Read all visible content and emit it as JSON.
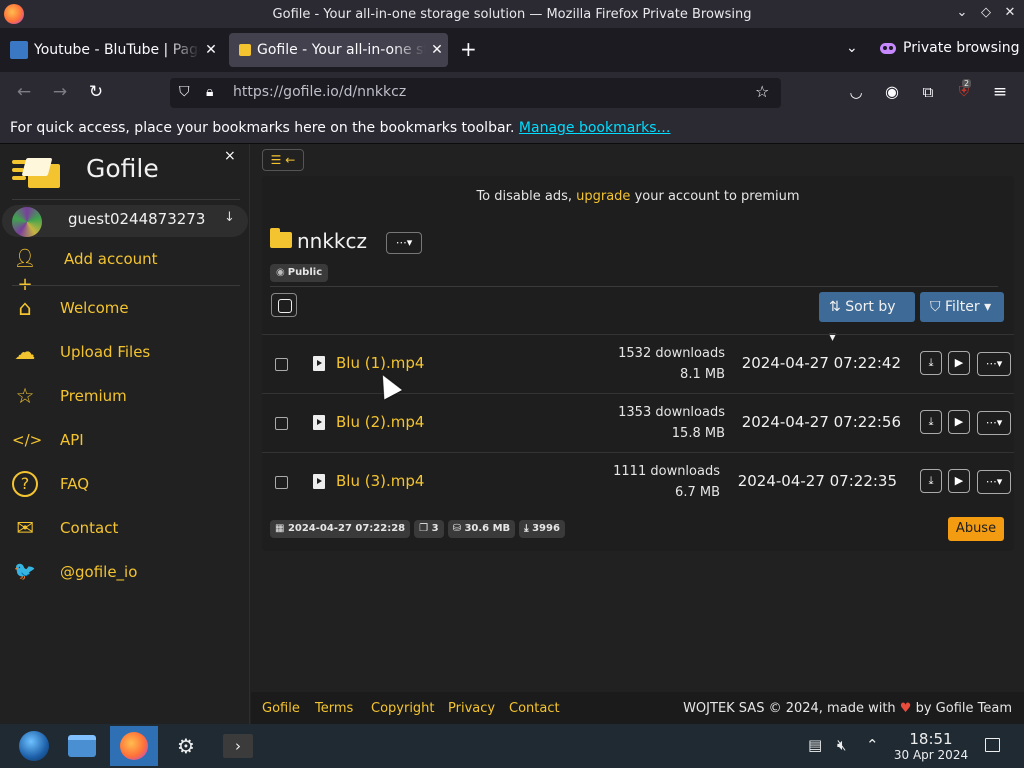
{
  "window": {
    "title": "Gofile - Your all-in-one storage solution — Mozilla Firefox Private Browsing",
    "controls": [
      "⌄",
      "◇",
      "✕"
    ]
  },
  "tabs": [
    {
      "label": "Youtube - BluTube | Page",
      "favicon_color": "#3b78c4"
    },
    {
      "label": "Gofile - Your all-in-one st",
      "favicon_color": "#f4c430"
    }
  ],
  "private_label": "Private browsing",
  "urlbar": {
    "url": "https://gofile.io/d/nnkkcz"
  },
  "extensions_badge": "2",
  "bookmarks": {
    "message": "For quick access, place your bookmarks here on the bookmarks toolbar.",
    "link": "Manage bookmarks…"
  },
  "sidebar": {
    "brand": "Gofile",
    "close": "×",
    "account": {
      "name": "guest0244873273",
      "arrow": "↓"
    },
    "add_account": "Add account",
    "items": [
      {
        "label": "Welcome",
        "icon": "home-icon",
        "glyph": "⌂"
      },
      {
        "label": "Upload Files",
        "icon": "cloud-upload-icon",
        "glyph": "☁"
      },
      {
        "label": "Premium",
        "icon": "star-icon",
        "glyph": "☆"
      },
      {
        "label": "API",
        "icon": "code-icon",
        "glyph": "</>"
      },
      {
        "label": "FAQ",
        "icon": "question-icon",
        "glyph": "?"
      },
      {
        "label": "Contact",
        "icon": "envelope-icon",
        "glyph": "✉"
      },
      {
        "label": "@gofile_io",
        "icon": "twitter-icon",
        "glyph": "🐦"
      }
    ]
  },
  "main": {
    "toggle": "☰ ←",
    "ads": {
      "prefix": "To disable ads,",
      "link": "upgrade",
      "suffix": "your account to premium"
    },
    "folder": {
      "name": "nnkkcz",
      "menu": "⋯▾",
      "visibility": "Public"
    },
    "sort_label": "Sort by",
    "filter_label": "Filter",
    "files": [
      {
        "name": "Blu (1).mp4",
        "downloads": "1532 downloads",
        "size": "8.1 MB",
        "date": "2024-04-27 07:22:42"
      },
      {
        "name": "Blu (2).mp4",
        "downloads": "1353 downloads",
        "size": "15.8 MB",
        "date": "2024-04-27 07:22:56"
      },
      {
        "name": "Blu (3).mp4",
        "downloads": "1111 downloads",
        "size": "6.7 MB",
        "date": "2024-04-27 07:22:35"
      }
    ],
    "stats": {
      "created": "2024-04-27 07:22:28",
      "count": "3",
      "total_size": "30.6 MB",
      "total_downloads": "3996"
    },
    "abuse_label": "Abuse"
  },
  "footer": {
    "links": [
      "Gofile",
      "Terms",
      "Copyright",
      "Privacy",
      "Contact"
    ],
    "copyright_prefix": "WOJTEK SAS © 2024, made with",
    "copyright_suffix": "by Gofile Team"
  },
  "taskbar": {
    "time": "18:51",
    "date": "30 Apr 2024"
  }
}
